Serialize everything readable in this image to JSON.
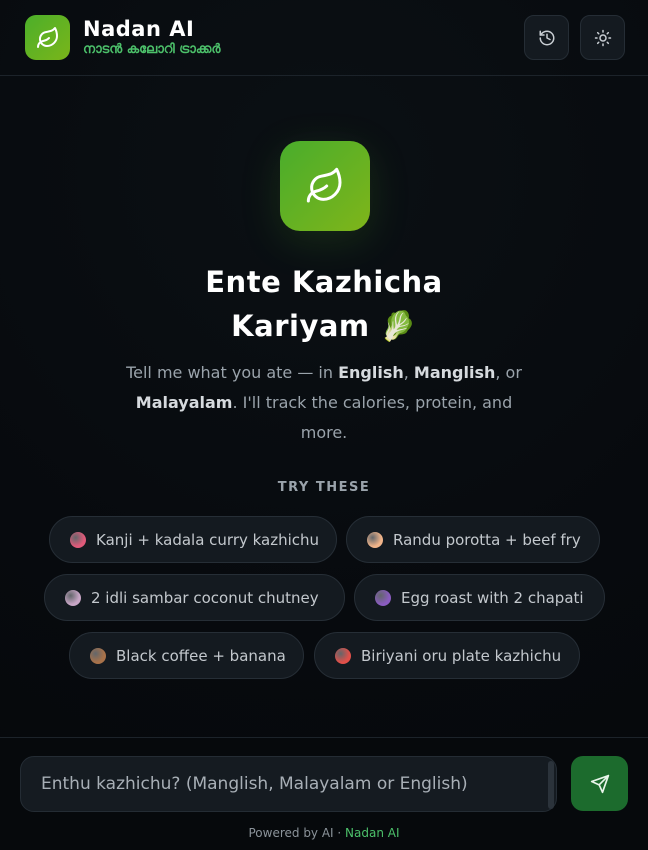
{
  "header": {
    "title": "Nadan AI",
    "subtitle": "നാടൻ കലോറി ട്രാക്കർ",
    "history_icon": "history-icon",
    "theme_icon": "sun-icon"
  },
  "hero": {
    "icon": "leaf-icon",
    "title_line1": "Ente Kazhicha",
    "title_line2": "Kariyam 🥬",
    "desc_part1": "Tell me what you ate — in ",
    "desc_english": "English",
    "desc_comma": ", ",
    "desc_manglish": "Manglish",
    "desc_part2": ", or ",
    "desc_malayalam": "Malayalam",
    "desc_part3": ". I'll track the calories, protein, and more."
  },
  "suggestions": {
    "label": "TRY THESE",
    "items": [
      {
        "emoji_color": "#e05a7a",
        "label": "Kanji + kadala curry kazhichu"
      },
      {
        "emoji_color": "#f0b48a",
        "label": "Randu porotta + beef fry"
      },
      {
        "emoji_color": "#c8a6c6",
        "label": "2 idli sambar coconut chutney"
      },
      {
        "emoji_color": "#8a5cc0",
        "label": "Egg roast with 2 chapati"
      },
      {
        "emoji_color": "#a8724a",
        "label": "Black coffee + banana"
      },
      {
        "emoji_color": "#e0504a",
        "label": "Biriyani oru plate kazhichu"
      }
    ]
  },
  "composer": {
    "placeholder": "Enthu kazhichu? (Manglish, Malayalam or English)",
    "send_icon": "send-icon"
  },
  "footer": {
    "prefix": "Powered by AI · ",
    "brand": "Nadan AI"
  },
  "colors": {
    "accent": "#4cc06a",
    "brand_gradient_start": "#49ad2c",
    "brand_gradient_end": "#7fb51a",
    "send_button": "#1c6b2d"
  }
}
